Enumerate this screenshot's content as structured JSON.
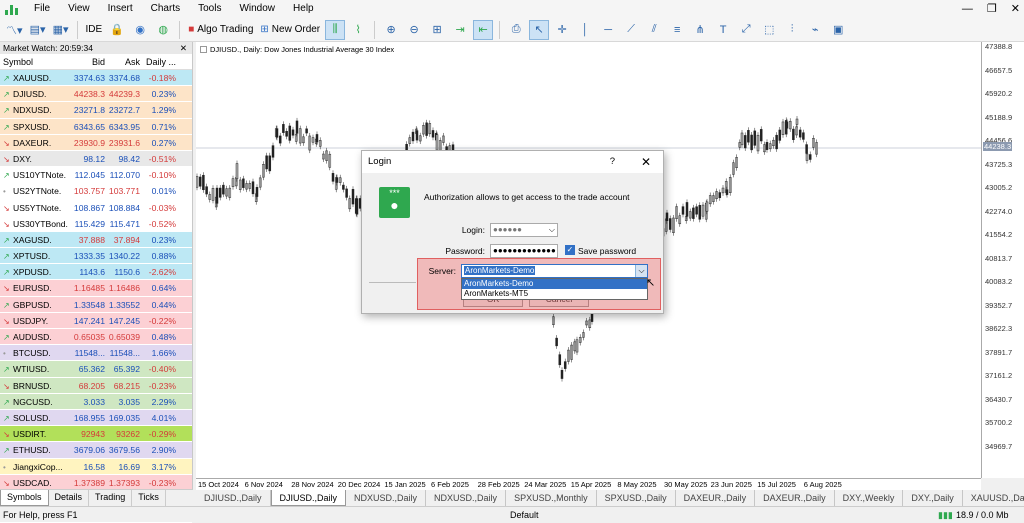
{
  "menu": {
    "items": [
      "File",
      "View",
      "Insert",
      "Charts",
      "Tools",
      "Window",
      "Help"
    ]
  },
  "toolbar": {
    "ide": "IDE",
    "algo": "Algo Trading",
    "new_order": "New Order"
  },
  "market_watch": {
    "title": "Market Watch: 20:59:34",
    "headers": [
      "Symbol",
      "Bid",
      "Ask",
      "Daily ..."
    ],
    "rows": [
      {
        "dir": "up",
        "symbol": "XAUUSD.",
        "bid": "3374.63",
        "ask": "3374.68",
        "change": "-0.18%",
        "color": "#bde8f4"
      },
      {
        "dir": "up",
        "symbol": "DJIUSD.",
        "bid": "44238.3",
        "ask": "44239.3",
        "change": "0.23%",
        "color": "#fde4c8"
      },
      {
        "dir": "up",
        "symbol": "NDXUSD.",
        "bid": "23271.8",
        "ask": "23272.7",
        "change": "1.29%",
        "color": "#fde4c8"
      },
      {
        "dir": "up",
        "symbol": "SPXUSD.",
        "bid": "6343.65",
        "ask": "6343.95",
        "change": "0.71%",
        "color": "#fde4c8"
      },
      {
        "dir": "down",
        "symbol": "DAXEUR.",
        "bid": "23930.9",
        "ask": "23931.6",
        "change": "0.27%",
        "color": "#fde4c8"
      },
      {
        "dir": "down",
        "symbol": "DXY.",
        "bid": "98.12",
        "ask": "98.42",
        "change": "-0.51%",
        "color": "#e8e8e8"
      },
      {
        "dir": "up",
        "symbol": "US10YTNote.",
        "bid": "112.045",
        "ask": "112.070",
        "change": "-0.10%",
        "color": "#ffffff"
      },
      {
        "dir": "dot",
        "symbol": "US2YTNote.",
        "bid": "103.757",
        "ask": "103.771",
        "change": "0.01%",
        "color": "#ffffff"
      },
      {
        "dir": "down",
        "symbol": "US5YTNote.",
        "bid": "108.867",
        "ask": "108.884",
        "change": "-0.03%",
        "color": "#ffffff"
      },
      {
        "dir": "down",
        "symbol": "US30YTBond.",
        "bid": "115.429",
        "ask": "115.471",
        "change": "-0.52%",
        "color": "#ffffff"
      },
      {
        "dir": "up",
        "symbol": "XAGUSD.",
        "bid": "37.888",
        "ask": "37.894",
        "change": "0.23%",
        "color": "#bde8f4"
      },
      {
        "dir": "up",
        "symbol": "XPTUSD.",
        "bid": "1333.35",
        "ask": "1340.22",
        "change": "0.88%",
        "color": "#bde8f4"
      },
      {
        "dir": "up",
        "symbol": "XPDUSD.",
        "bid": "1143.6",
        "ask": "1150.6",
        "change": "-2.62%",
        "color": "#bde8f4"
      },
      {
        "dir": "down",
        "symbol": "EURUSD.",
        "bid": "1.16485",
        "ask": "1.16486",
        "change": "0.64%",
        "color": "#fcd0d4"
      },
      {
        "dir": "up",
        "symbol": "GBPUSD.",
        "bid": "1.33548",
        "ask": "1.33552",
        "change": "0.44%",
        "color": "#fcd0d4"
      },
      {
        "dir": "down",
        "symbol": "USDJPY.",
        "bid": "147.241",
        "ask": "147.245",
        "change": "-0.22%",
        "color": "#fcd0d4"
      },
      {
        "dir": "up",
        "symbol": "AUDUSD.",
        "bid": "0.65035",
        "ask": "0.65039",
        "change": "0.48%",
        "color": "#fcd0d4"
      },
      {
        "dir": "dot",
        "symbol": "BTCUSD.",
        "bid": "11548...",
        "ask": "11548...",
        "change": "1.66%",
        "color": "#e0d8f0"
      },
      {
        "dir": "up",
        "symbol": "WTIUSD.",
        "bid": "65.362",
        "ask": "65.392",
        "change": "-0.40%",
        "color": "#cfe7c2"
      },
      {
        "dir": "down",
        "symbol": "BRNUSD.",
        "bid": "68.205",
        "ask": "68.215",
        "change": "-0.23%",
        "color": "#cfe7c2"
      },
      {
        "dir": "up",
        "symbol": "NGCUSD.",
        "bid": "3.033",
        "ask": "3.035",
        "change": "2.29%",
        "color": "#cfe7c2"
      },
      {
        "dir": "up",
        "symbol": "SOLUSD.",
        "bid": "168.955",
        "ask": "169.035",
        "change": "4.01%",
        "color": "#e0d8f0"
      },
      {
        "dir": "down",
        "symbol": "USDIRT.",
        "bid": "92943",
        "ask": "93262",
        "change": "-0.29%",
        "color": "#b2e05a"
      },
      {
        "dir": "up",
        "symbol": "ETHUSD.",
        "bid": "3679.06",
        "ask": "3679.56",
        "change": "2.90%",
        "color": "#e0d8f0"
      },
      {
        "dir": "dot",
        "symbol": "JiangxiCop...",
        "bid": "16.58",
        "ask": "16.69",
        "change": "3.17%",
        "color": "#fff4c0"
      },
      {
        "dir": "down",
        "symbol": "USDCAD.",
        "bid": "1.37389",
        "ask": "1.37393",
        "change": "-0.23%",
        "color": "#fcd0d4"
      },
      {
        "dir": "up",
        "symbol": "EURGBP.",
        "bid": "0.87221",
        "ask": "0.87224",
        "change": "0.24%",
        "color": "#fcd0d4"
      },
      {
        "dir": "down",
        "symbol": "USDCHF.",
        "bid": "0.80694",
        "ask": "0.80698",
        "change": "-0.05%",
        "color": "#fcd0d4"
      }
    ],
    "tabs": [
      "Symbols",
      "Details",
      "Trading",
      "Ticks"
    ]
  },
  "chart": {
    "label": "DJIUSD., Daily:  Dow Jones Industrial Average 30 Index",
    "price_labels": [
      "47388.8",
      "46657.5",
      "45920.2",
      "45188.9",
      "44456.6",
      "43725.3",
      "43005.2",
      "42274.0",
      "41554.2",
      "40813.7",
      "40083.2",
      "39352.7",
      "38622.3",
      "37891.7",
      "37161.2",
      "36430.7",
      "35700.2",
      "34969.7"
    ],
    "current_price": "44238.3",
    "dates": [
      "15 Oct 2024",
      "6 Nov 2024",
      "28 Nov 2024",
      "20 Dec 2024",
      "15 Jan 2025",
      "6 Feb 2025",
      "28 Feb 2025",
      "24 Mar 2025",
      "15 Apr 2025",
      "8 May 2025",
      "30 May 2025",
      "23 Jun 2025",
      "15 Jul 2025",
      "6 Aug 2025"
    ]
  },
  "chart_tabs": [
    "DJIUSD.,Daily",
    "DJIUSD.,Daily",
    "NDXUSD.,Daily",
    "NDXUSD.,Daily",
    "SPXUSD.,Monthly",
    "SPXUSD.,Daily",
    "DAXEUR.,Daily",
    "DAXEUR.,Daily",
    "DXY.,Weekly",
    "DXY.,Daily",
    "XAUUSD.,Dail"
  ],
  "dialog": {
    "title": "Login",
    "help": "?",
    "close": "✕",
    "message": "Authorization allows to get access to the trade account",
    "login_label": "Login:",
    "login_value": "●●●●●●",
    "password_label": "Password:",
    "password_value": "●●●●●●●●●●●●●",
    "save_password": "Save password",
    "server_label": "Server:",
    "server_value": "AronMarkets-Demo",
    "server_options": [
      "AronMarkets-Demo",
      "AronMarkets-MT5"
    ],
    "ok": "OK",
    "cancel": "Cancel"
  },
  "status": {
    "help": "For Help, press F1",
    "profile": "Default",
    "traffic": "18.9 / 0.0 Mb"
  }
}
